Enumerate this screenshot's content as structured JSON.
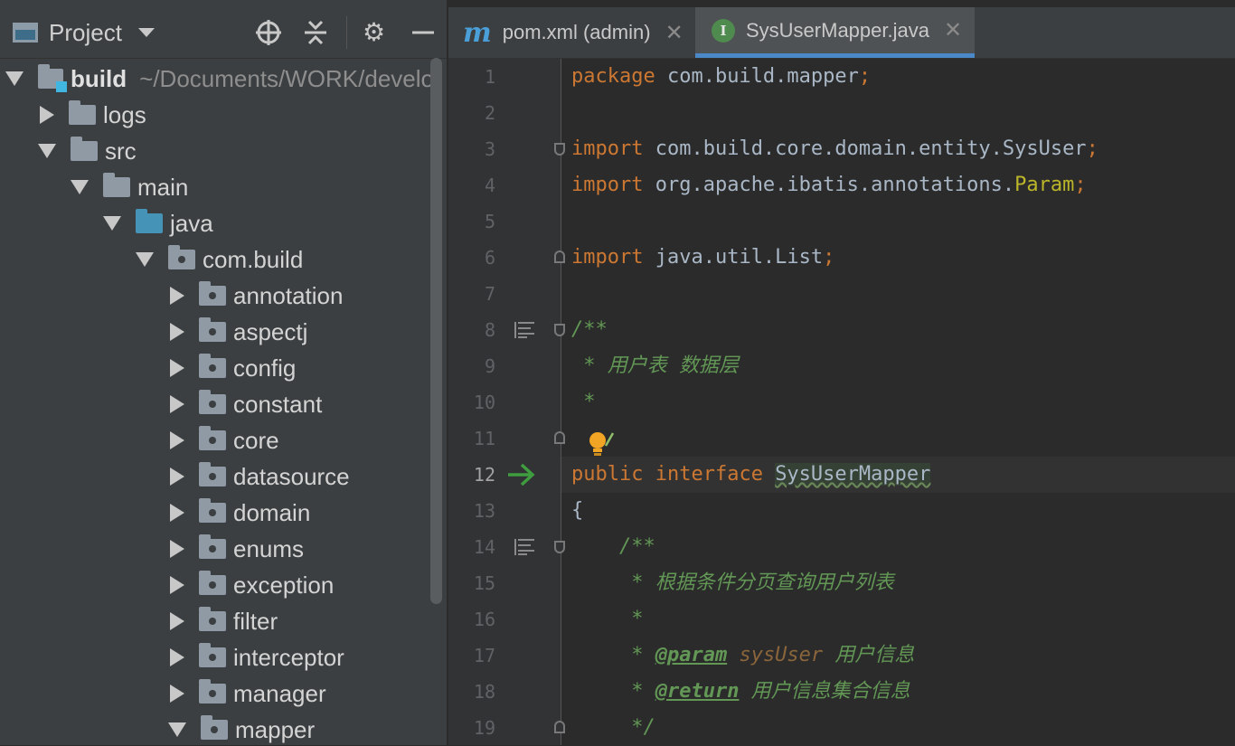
{
  "project_panel": {
    "title": "Project",
    "tree": [
      {
        "label": "build",
        "extra": "~/Documents/WORK/develo",
        "kind": "module",
        "expanded": true,
        "depth": 0
      },
      {
        "label": "logs",
        "kind": "folder",
        "expanded": false,
        "depth": 1
      },
      {
        "label": "src",
        "kind": "folder",
        "expanded": true,
        "depth": 1
      },
      {
        "label": "main",
        "kind": "folder",
        "expanded": true,
        "depth": 2
      },
      {
        "label": "java",
        "kind": "source",
        "expanded": true,
        "depth": 3
      },
      {
        "label": "com.build",
        "kind": "package",
        "expanded": true,
        "depth": 4
      },
      {
        "label": "annotation",
        "kind": "package",
        "expanded": false,
        "depth": 5
      },
      {
        "label": "aspectj",
        "kind": "package",
        "expanded": false,
        "depth": 5
      },
      {
        "label": "config",
        "kind": "package",
        "expanded": false,
        "depth": 5
      },
      {
        "label": "constant",
        "kind": "package",
        "expanded": false,
        "depth": 5
      },
      {
        "label": "core",
        "kind": "package",
        "expanded": false,
        "depth": 5
      },
      {
        "label": "datasource",
        "kind": "package",
        "expanded": false,
        "depth": 5
      },
      {
        "label": "domain",
        "kind": "package",
        "expanded": false,
        "depth": 5
      },
      {
        "label": "enums",
        "kind": "package",
        "expanded": false,
        "depth": 5
      },
      {
        "label": "exception",
        "kind": "package",
        "expanded": false,
        "depth": 5
      },
      {
        "label": "filter",
        "kind": "package",
        "expanded": false,
        "depth": 5
      },
      {
        "label": "interceptor",
        "kind": "package",
        "expanded": false,
        "depth": 5
      },
      {
        "label": "manager",
        "kind": "package",
        "expanded": false,
        "depth": 5
      },
      {
        "label": "mapper",
        "kind": "package",
        "expanded": true,
        "depth": 5
      }
    ]
  },
  "tabs": [
    {
      "icon": "maven-m-icon",
      "icon_text": "m",
      "label": "pom.xml (admin)",
      "active": false
    },
    {
      "icon": "interface-icon",
      "icon_text": "I",
      "label": "SysUserMapper.java",
      "active": true
    }
  ],
  "editor": {
    "current_line": 12,
    "line_numbers": [
      "1",
      "2",
      "3",
      "4",
      "5",
      "6",
      "7",
      "8",
      "9",
      "10",
      "11",
      "12",
      "13",
      "14",
      "15",
      "16",
      "17",
      "18",
      "19"
    ],
    "code": {
      "l1_kw": "package",
      "l1_rest": " com.build.mapper",
      "l1_semi": ";",
      "l3_kw": "import",
      "l3_rest": " com.build.core.domain.entity.SysUser",
      "l3_semi": ";",
      "l4_kw": "import",
      "l4_rest": " org.apache.ibatis.annotations.",
      "l4_ann": "Param",
      "l4_semi": ";",
      "l6_kw": "import",
      "l6_rest": " java.util.List",
      "l6_semi": ";",
      "l8": "/**",
      "l9": " * 用户表 数据层",
      "l10": " *",
      "l12_kw1": "public",
      "l12_kw2": " interface ",
      "l12_name": "SysUserMapper",
      "l13": "{",
      "l14": "    /**",
      "l15": "     * 根据条件分页查询用户列表",
      "l16": "     *",
      "l17_pre": "     * ",
      "l17_tag": "@param",
      "l17_param": " sysUser",
      "l17_text": " 用户信息",
      "l18_pre": "     * ",
      "l18_tag": "@return",
      "l18_text": " 用户信息集合信息",
      "l19": "     */"
    }
  },
  "colors": {
    "keyword": "#cc7832",
    "comment": "#629755",
    "annotation": "#bbb529",
    "accent": "#4a88c7"
  }
}
